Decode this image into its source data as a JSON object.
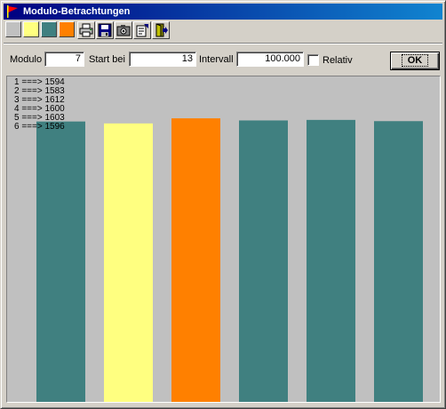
{
  "window": {
    "title": "Modulo-Betrachtungen"
  },
  "toolbar": {
    "swatches": [
      {
        "name": "swatch-gray",
        "color": "#c0c0c0"
      },
      {
        "name": "swatch-yellow",
        "color": "#ffff80"
      },
      {
        "name": "swatch-teal",
        "color": "#408080"
      },
      {
        "name": "swatch-orange",
        "color": "#ff8000"
      }
    ],
    "buttons": [
      {
        "name": "print-icon"
      },
      {
        "name": "save-icon"
      },
      {
        "name": "camera-icon"
      },
      {
        "name": "properties-icon"
      },
      {
        "name": "exit-icon"
      }
    ]
  },
  "params": {
    "modulo_label": "Modulo",
    "modulo_value": "7",
    "start_label": "Start bei",
    "start_value": "13",
    "interval_label": "Intervall",
    "interval_value": "100.000",
    "relativ_label": "Relativ",
    "relativ_checked": false,
    "ok_label": "OK"
  },
  "chart_data": {
    "type": "bar",
    "categories": [
      "1",
      "2",
      "3",
      "4",
      "5",
      "6"
    ],
    "values": [
      1594,
      1583,
      1612,
      1600,
      1603,
      1596
    ],
    "legend": [
      "1 ===> 1594",
      "2 ===> 1583",
      "3 ===> 1612",
      "4 ===> 1600",
      "5 ===> 1603",
      "6 ===> 1596"
    ],
    "colors": [
      "#408080",
      "#ffff80",
      "#ff8000",
      "#408080",
      "#408080",
      "#408080"
    ],
    "background": "#c0c0c0",
    "ylim": [
      0,
      1850
    ]
  }
}
